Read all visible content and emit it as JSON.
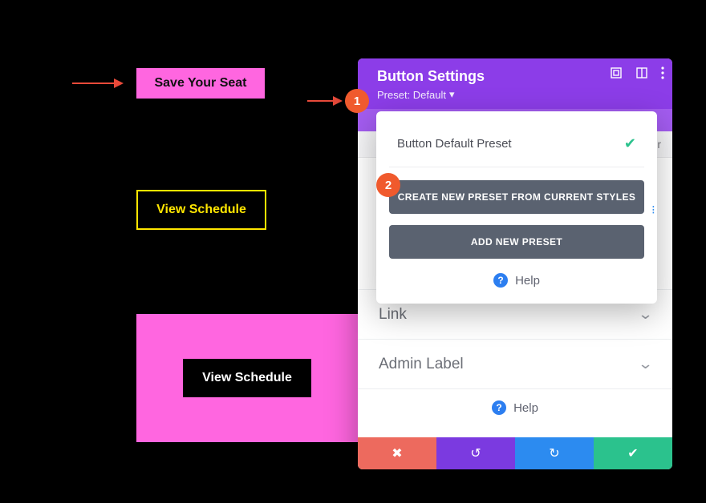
{
  "buttons": {
    "save_seat": "Save Your Seat",
    "view_schedule_1": "View Schedule",
    "view_schedule_2": "View Schedule"
  },
  "annotations": {
    "badge1": "1",
    "badge2": "2"
  },
  "panel": {
    "title": "Button Settings",
    "preset_label": "Preset: Default",
    "tab_right": "r",
    "accordion": {
      "link": "Link",
      "admin": "Admin Label"
    },
    "help": "Help"
  },
  "popover": {
    "default_item": "Button Default Preset",
    "create_from_current": "CREATE NEW PRESET FROM CURRENT STYLES",
    "add_new": "ADD NEW PRESET",
    "help": "Help"
  }
}
